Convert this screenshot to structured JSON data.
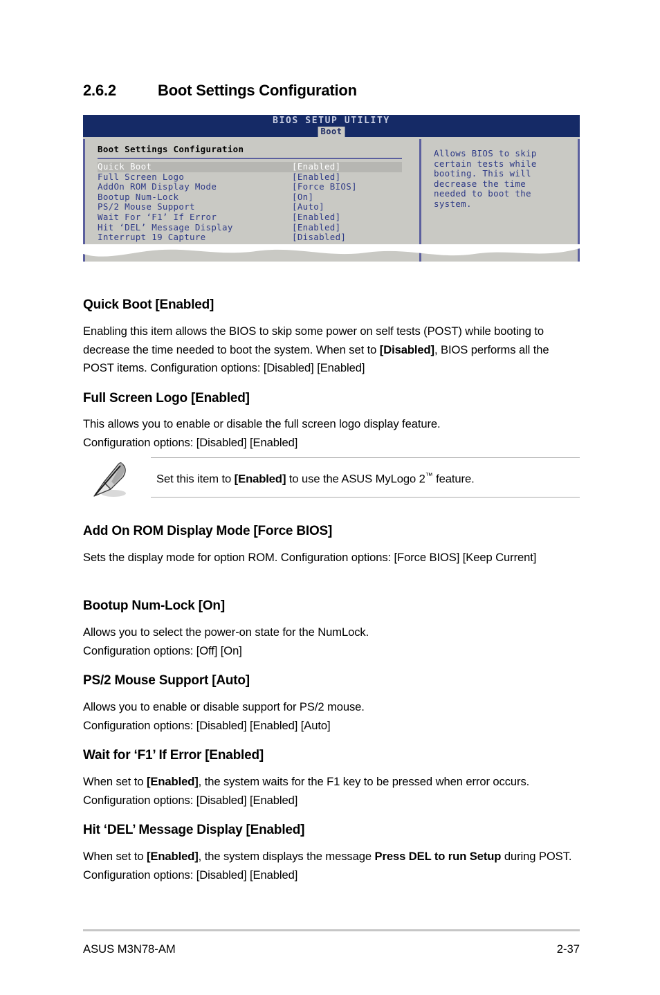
{
  "section": {
    "number": "2.6.2",
    "title": "Boot Settings Configuration"
  },
  "bios": {
    "utility_title": "BIOS SETUP UTILITY",
    "active_tab": "Boot",
    "panel_title": "Boot Settings Configuration",
    "items": [
      {
        "label": "Quick Boot",
        "value": "[Enabled]",
        "selected": true
      },
      {
        "label": "Full Screen Logo",
        "value": "[Enabled]",
        "selected": false
      },
      {
        "label": "AddOn ROM Display Mode",
        "value": "[Force BIOS]",
        "selected": false
      },
      {
        "label": "Bootup Num-Lock",
        "value": "[On]",
        "selected": false
      },
      {
        "label": "PS/2 Mouse Support",
        "value": "[Auto]",
        "selected": false
      },
      {
        "label": "Wait For ‘F1’ If Error",
        "value": "[Enabled]",
        "selected": false
      },
      {
        "label": "Hit ‘DEL’ Message Display",
        "value": "[Enabled]",
        "selected": false
      },
      {
        "label": "Interrupt 19 Capture",
        "value": "[Disabled]",
        "selected": false
      }
    ],
    "help_text": "Allows BIOS to skip\ncertain tests while\nbooting. This will\ndecrease the time\nneeded to boot the\nsystem.",
    "colors": {
      "header_bg": "#152a66",
      "panel_bg": "#c9c9c4",
      "border": "#5b5f9e",
      "text_blue": "#2e3a86",
      "selected_bg": "#b6b6b2"
    }
  },
  "sections": [
    {
      "heading": "Quick Boot [Enabled]",
      "body_html": "Enabling this item allows the BIOS to skip some power on self tests (POST) while booting to decrease the time needed to boot the system. When set to <b>[Disabled]</b>, BIOS performs all the POST items. Configuration options: [Disabled] [Enabled]"
    },
    {
      "heading": "Full Screen Logo [Enabled]",
      "body_html": "This allows you to enable or disable the full screen logo display feature.<br>Configuration options: [Disabled] [Enabled]"
    },
    {
      "heading": "Add On ROM Display Mode [Force BIOS]",
      "body_html": "Sets the display mode for option ROM. Configuration options: [Force BIOS] [Keep Current]"
    },
    {
      "heading": "Bootup Num-Lock [On]",
      "body_html": "Allows you to select the power-on state for the NumLock.<br>Configuration options: [Off] [On]"
    },
    {
      "heading": "PS/2 Mouse Support [Auto]",
      "body_html": "Allows you to enable or disable support for PS/2 mouse.<br>Configuration options: [Disabled] [Enabled] [Auto]"
    },
    {
      "heading": "Wait for ‘F1’ If Error [Enabled]",
      "body_html": "When set to <b>[Enabled]</b>, the system waits for the F1 key to be pressed when error occurs. Configuration options: [Disabled] [Enabled]"
    },
    {
      "heading": "Hit ‘DEL’ Message Display [Enabled]",
      "body_html": "When set to <b>[Enabled]</b>, the system displays the message <b>Press DEL to run Setup</b> during POST. Configuration options: [Disabled] [Enabled]"
    }
  ],
  "note": {
    "icon": "pencil-note-icon",
    "text_html": "Set this item to <b>[Enabled]</b> to use the ASUS MyLogo 2<span class=\"tm\">™</span> feature."
  },
  "footer": {
    "left": "ASUS M3N78-AM",
    "right": "2-37"
  }
}
